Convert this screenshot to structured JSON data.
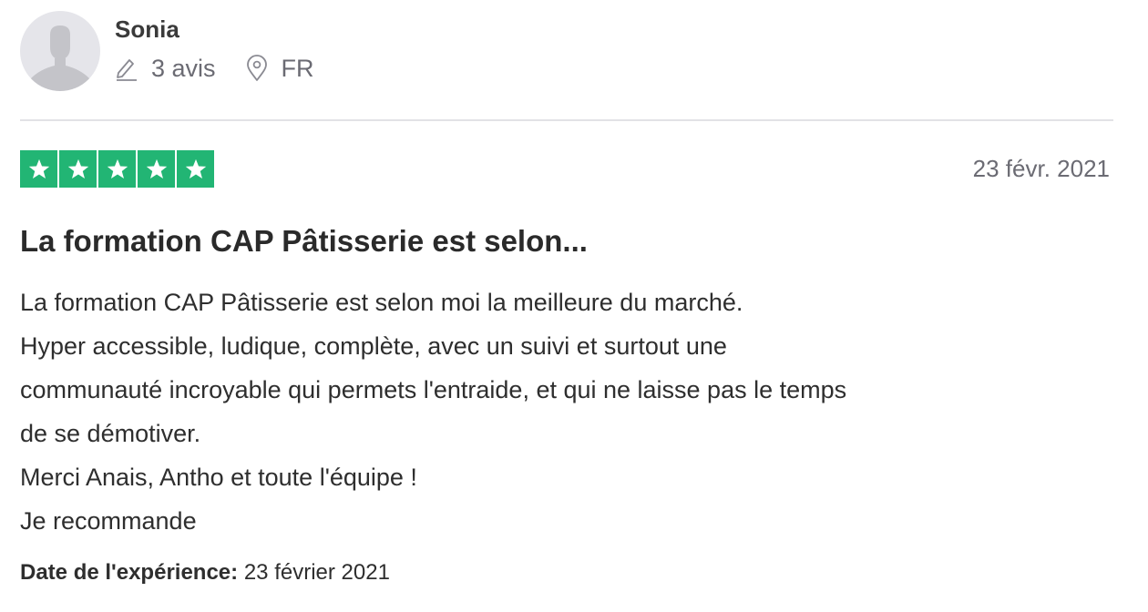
{
  "consumer": {
    "name": "Sonia",
    "reviews_count": "3 avis",
    "country": "FR",
    "avatar_icon": "user-silhouette-icon"
  },
  "review": {
    "rating": 5,
    "rating_max": 5,
    "star_color": "#22b574",
    "date": "23 févr. 2021",
    "title": "La formation CAP Pâtisserie est selon...",
    "body_lines": [
      "La formation CAP Pâtisserie est selon moi la meilleure du marché.",
      "Hyper accessible, ludique, complète, avec un suivi et surtout une",
      "communauté incroyable qui permets l'entraide, et qui ne laisse pas le temps",
      "de se démotiver.",
      "Merci Anais, Antho et toute l'équipe !",
      "Je recommande"
    ],
    "experience_label": "Date de l'expérience:",
    "experience_date": "23 février 2021"
  },
  "icons": {
    "reviews": "pencil-icon",
    "location": "location-pin-icon",
    "star": "star-icon"
  }
}
